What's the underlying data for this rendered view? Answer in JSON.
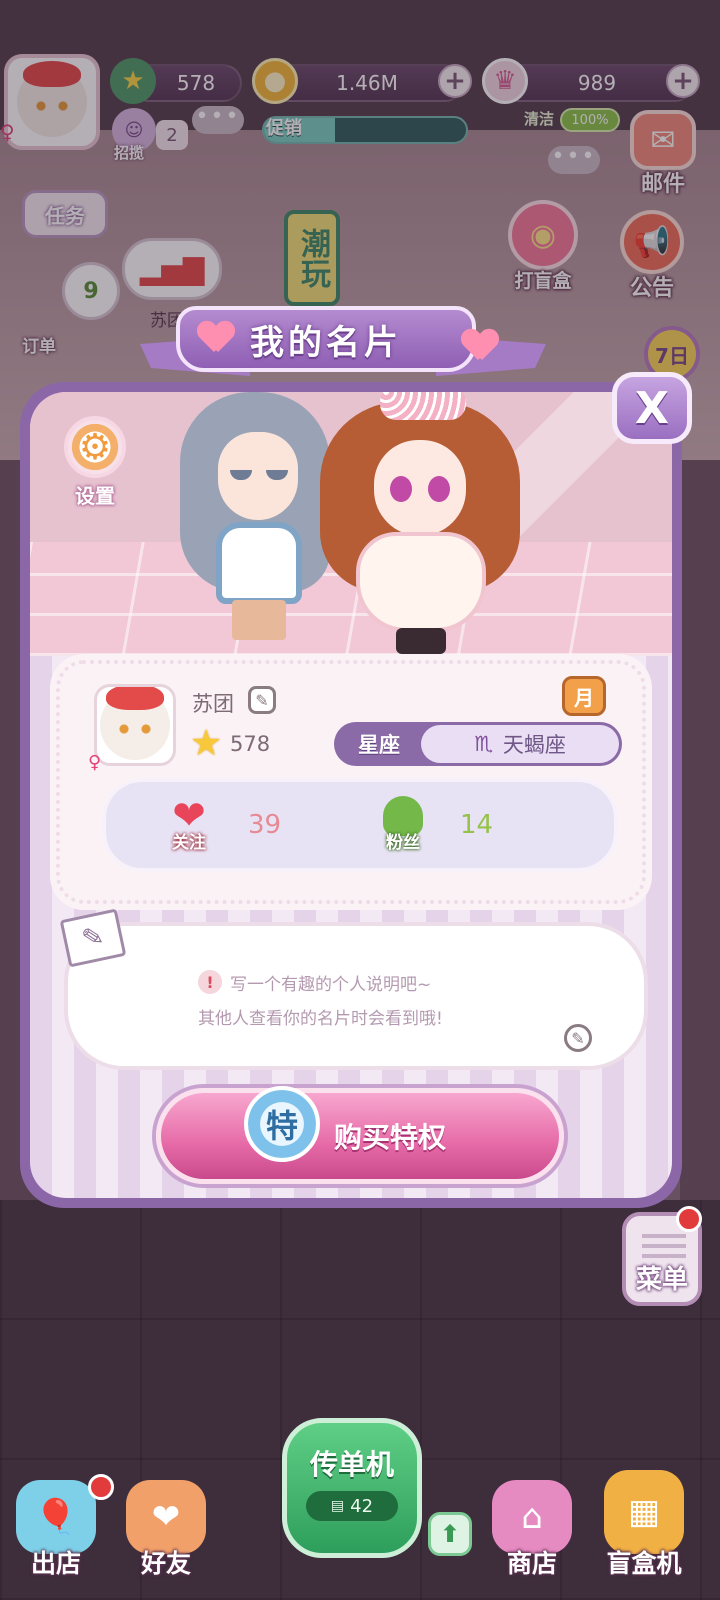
{
  "hud": {
    "stars": "578",
    "coins": "1.46M",
    "gems": "989",
    "recruit_label": "招揽",
    "recruit_count": "2",
    "promo_label": "促销",
    "promo_progress": 0.35,
    "clean_label": "清洁",
    "clean_value": "100%"
  },
  "left_side": {
    "task_label": "任务",
    "order_count": "9",
    "order_label": "订单",
    "shop_name": "苏团"
  },
  "right_side": {
    "mail_label": "邮件",
    "blindbox_label": "打盲盒",
    "notice_label": "公告",
    "seven_day": "7日"
  },
  "shop_sign": "潮玩",
  "card": {
    "title": "我的名片",
    "close_label": "X",
    "settings_label": "设置",
    "username": "苏团",
    "level": "578",
    "month_badge": "月",
    "zodiac_key": "星座",
    "zodiac_symbol": "♏",
    "zodiac_value": "天蝎座",
    "follow_label": "关注",
    "follow_count": "39",
    "fans_label": "粉丝",
    "fans_count": "14",
    "bio_line1": "写一个有趣的个人说明吧~",
    "bio_line2": "其他人查看你的名片时会看到哦!",
    "special_badge": "特",
    "buy_label": "购买特权"
  },
  "bottom": {
    "leave_label": "出店",
    "friends_label": "好友",
    "flyer_title": "传单机",
    "flyer_count": "42",
    "shop_label": "商店",
    "blindbox_machine_label": "盲盒机",
    "menu_label": "菜单"
  },
  "colors": {
    "card_border": "#8c67a8",
    "buy_button": "#e66aa7",
    "flyer_button": "#2e9e5c",
    "accent_pink": "#ff8fb0"
  }
}
